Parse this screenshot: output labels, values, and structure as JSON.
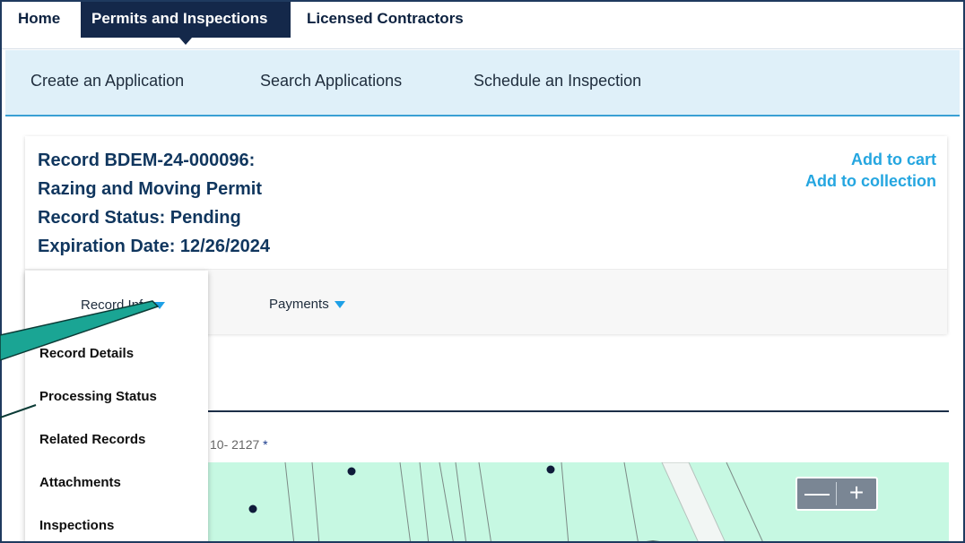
{
  "topnav": {
    "items": [
      {
        "label": "Home"
      },
      {
        "label": "Permits and Inspections"
      },
      {
        "label": "Licensed Contractors"
      }
    ]
  },
  "subnav": {
    "items": [
      {
        "label": "Create an Application"
      },
      {
        "label": "Search Applications"
      },
      {
        "label": "Schedule an Inspection"
      }
    ]
  },
  "record": {
    "line1": "Record BDEM-24-000096:",
    "line2": "Razing and Moving Permit",
    "line3": "Record Status: Pending",
    "line4": "Expiration Date: 12/26/2024",
    "add_to_cart": "Add to cart",
    "add_to_collection": "Add to collection"
  },
  "tabs": {
    "record_info": "Record Info",
    "payments": "Payments"
  },
  "menu": {
    "items": [
      {
        "label": "Record Details"
      },
      {
        "label": "Processing Status"
      },
      {
        "label": "Related Records"
      },
      {
        "label": "Attachments"
      },
      {
        "label": "Inspections"
      }
    ]
  },
  "address": {
    "partial": "10- 2127",
    "required_mark": "*"
  },
  "map": {
    "zoom_out": "—",
    "zoom_in": "+"
  },
  "colors": {
    "nav_active": "#14284a",
    "subnav_bg": "#dff0f9",
    "record_text": "#10365e",
    "link": "#25a6e0",
    "map_bg": "#c6f8e2",
    "callout": "#1aa594"
  }
}
